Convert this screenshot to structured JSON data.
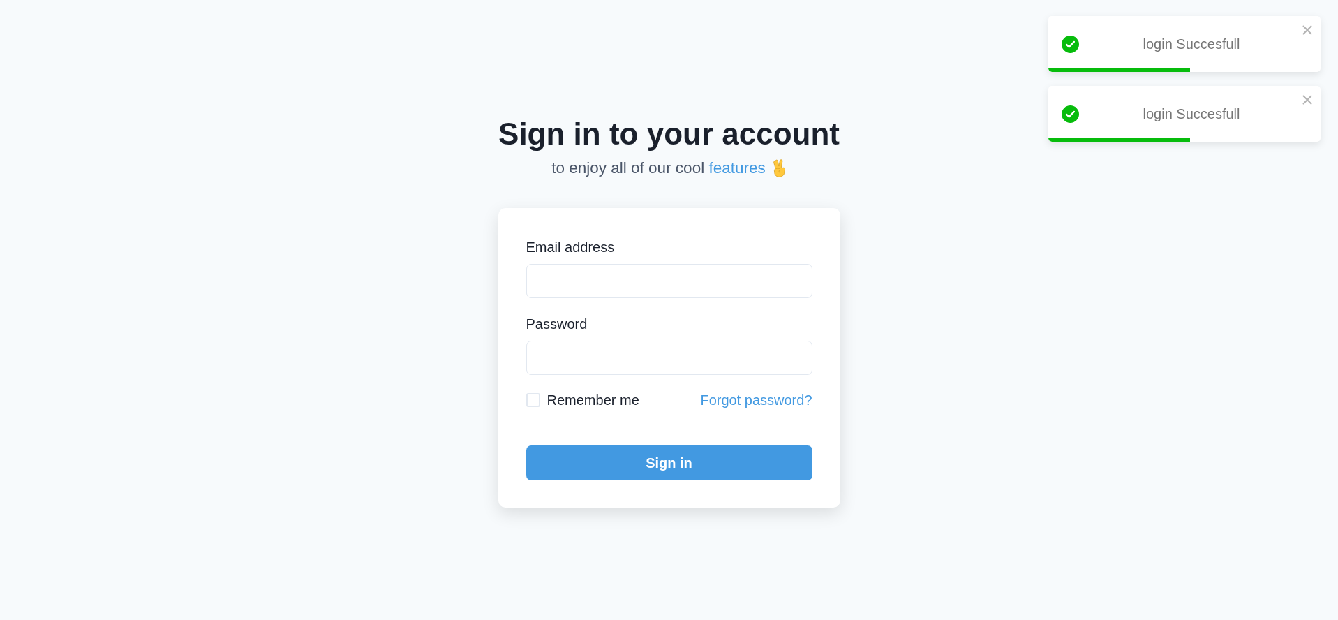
{
  "toasts": [
    {
      "kind": "success",
      "message": "login Succesfull",
      "level": 0.52
    },
    {
      "kind": "success",
      "message": "login Succesfull",
      "level": 0.52
    }
  ],
  "header": {
    "title": "Sign in to your account",
    "subtitle": "to enjoy all of our cool ",
    "link": "features"
  },
  "form": {
    "fields": [
      {
        "label": "Email address"
      },
      {
        "label": "Password"
      }
    ],
    "remember": {
      "label": "Remember me",
      "checked": false
    },
    "forgot_link": "Forgot password?",
    "submit": "Sign in"
  }
}
